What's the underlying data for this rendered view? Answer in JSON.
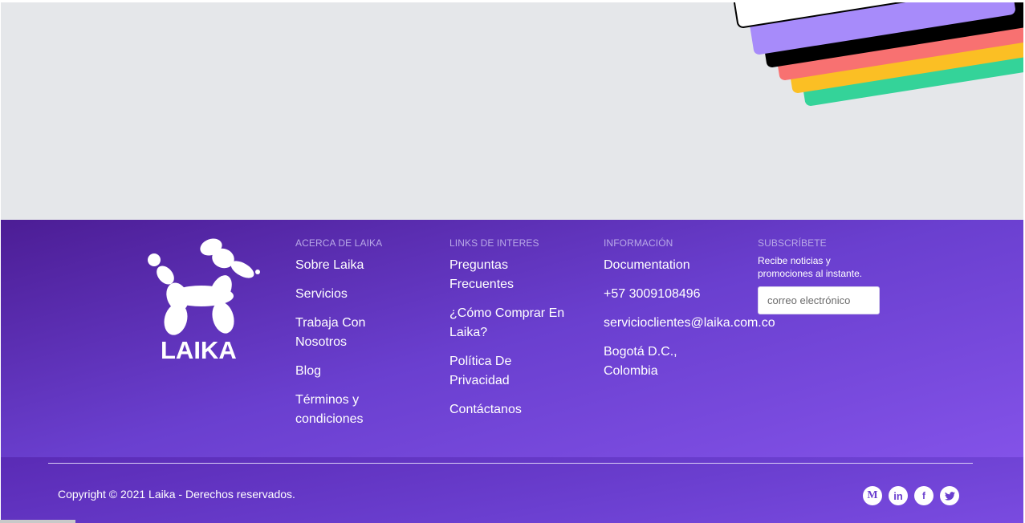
{
  "brand": {
    "name": "LAIKA"
  },
  "colors": {
    "footer_start": "#4c1d95",
    "footer_end": "#8352e8",
    "card_colors": [
      "#34d399",
      "#fbbf24",
      "#f87171",
      "#000000",
      "#a78bfa",
      "#ffffff"
    ]
  },
  "footer": {
    "columns": [
      {
        "heading": "ACERCA DE LAIKA",
        "links": [
          "Sobre Laika",
          "Servicios",
          "Trabaja Con Nosotros",
          "Blog",
          "Términos y condiciones"
        ]
      },
      {
        "heading": "LINKS DE INTERES",
        "links": [
          "Preguntas Frecuentes",
          "¿Cómo Comprar En Laika?",
          "Política De Privacidad",
          "Contáctanos"
        ]
      },
      {
        "heading": "INFORMACIÓN",
        "links": [
          "Documentation",
          "+57 3009108496",
          "servicioclientes@laika.com.co",
          "Bogotá D.C., Colombia"
        ]
      }
    ],
    "subscribe": {
      "heading": "SUBSCRÍBETE",
      "text": "Recibe noticias y promociones al instante.",
      "placeholder": "correo electrónico"
    }
  },
  "bottom": {
    "copyright": "Copyright © 2021 Laika - Derechos reservados.",
    "socials": [
      {
        "icon": "medium-icon",
        "glyph": "M"
      },
      {
        "icon": "linkedin-icon",
        "glyph": "in"
      },
      {
        "icon": "facebook-icon",
        "glyph": "f"
      },
      {
        "icon": "twitter-icon",
        "glyph": "t"
      }
    ]
  }
}
